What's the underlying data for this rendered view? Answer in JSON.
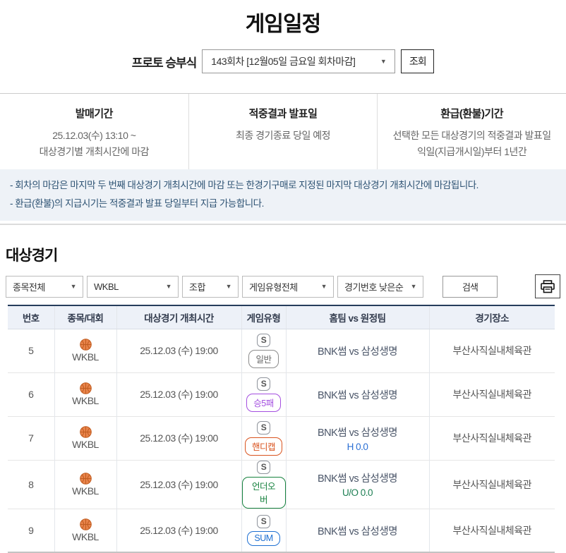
{
  "page": {
    "title": "게임일정"
  },
  "round_selector": {
    "label": "프로토 승부식",
    "selected_round": "143회차 [12월05일 금요일 회차마감]",
    "inquiry_button": "조회"
  },
  "info": {
    "columns": [
      {
        "title": "발매기간",
        "line1": "25.12.03(수) 13:10 ~",
        "line2": "대상경기별 개최시간에 마감"
      },
      {
        "title": "적중결과 발표일",
        "line1": "최종 경기종료 당일 예정",
        "line2": ""
      },
      {
        "title": "환급(환불)기간",
        "line1": "선택한 모든 대상경기의 적중결과 발표일",
        "line2": "익일(지급개시일)부터 1년간"
      }
    ]
  },
  "notices": {
    "line1": "- 회차의 마감은 마지막 두 번째 대상경기 개최시간에 마감 또는 한경기구매로 지정된 마지막 대상경기 개최시간에 마감됩니다.",
    "line2": "- 환급(환불)의 지급시기는 적중결과 발표 당일부터 지급 가능합니다."
  },
  "games_section": {
    "title": "대상경기",
    "filters": {
      "sport": "종목전체",
      "league": "WKBL",
      "combo": "조합",
      "game_type": "게임유형전체",
      "sort": "경기번호 낮은순"
    },
    "search_button": "검색",
    "print_icon": "printer-icon",
    "table": {
      "headers": [
        "번호",
        "종목/대회",
        "대상경기 개최시간",
        "게임유형",
        "홈팀 vs 원정팀",
        "경기장소"
      ],
      "single_icon_label": "S",
      "rows": [
        {
          "no": "5",
          "league": "WKBL",
          "time": "25.12.03 (수) 19:00",
          "type": "일반",
          "type_color": "#8c8c8c",
          "type_text_color": "#666666",
          "teams": "BNK썸  vs  삼성생명",
          "sub": "",
          "sub_color": "",
          "venue": "부산사직실내체육관"
        },
        {
          "no": "6",
          "league": "WKBL",
          "time": "25.12.03 (수) 19:00",
          "type": "승5패",
          "type_color": "#a44fe0",
          "type_text_color": "#a44fe0",
          "teams": "BNK썸  vs  삼성생명",
          "sub": "",
          "sub_color": "",
          "venue": "부산사직실내체육관"
        },
        {
          "no": "7",
          "league": "WKBL",
          "time": "25.12.03 (수) 19:00",
          "type": "핸디캡",
          "type_color": "#d9531e",
          "type_text_color": "#d9531e",
          "teams": "BNK썸  vs  삼성생명",
          "sub": "H 0.0",
          "sub_color": "#2b6fd4",
          "venue": "부산사직실내체육관"
        },
        {
          "no": "8",
          "league": "WKBL",
          "time": "25.12.03 (수) 19:00",
          "type": "언더오버",
          "type_color": "#17823f",
          "type_text_color": "#17823f",
          "teams": "BNK썸  vs  삼성생명",
          "sub": "U/O 0.0",
          "sub_color": "#1c7e52",
          "venue": "부산사직실내체육관"
        },
        {
          "no": "9",
          "league": "WKBL",
          "time": "25.12.03 (수) 19:00",
          "type": "SUM",
          "type_color": "#1d6fd2",
          "type_text_color": "#1d6fd2",
          "teams": "BNK썸  vs  삼성생명",
          "sub": "",
          "sub_color": "",
          "venue": "부산사직실내체육관"
        }
      ]
    }
  },
  "colors": {
    "table_top_border": "#263c5c",
    "thead_bg": "#edf1f8",
    "notice_bg": "#eef2f7",
    "notice_text": "#2d5273"
  }
}
